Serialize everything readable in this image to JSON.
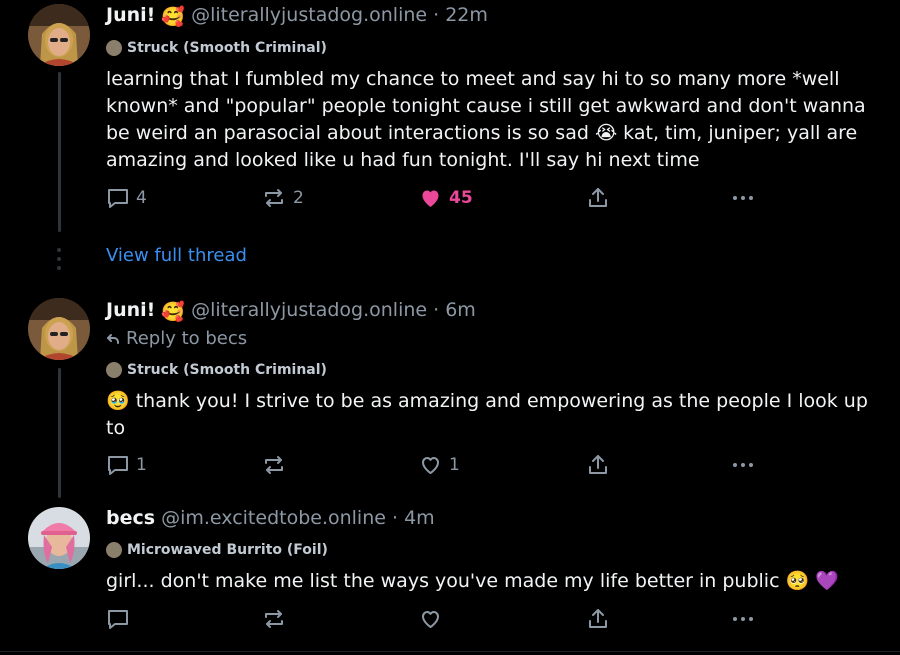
{
  "posts": [
    {
      "display_name": "Juni!",
      "handle": "@literallyjustadog.online",
      "time": "· 22m",
      "label": "Struck (Smooth Criminal)",
      "text": "learning that I fumbled my chance to meet and say hi to so many more *well known* and \"popular\" people tonight cause i still get awkward and don't wanna be weird an parasocial about interactions is so sad 😭 kat, tim, juniper; yall are amazing and looked like u had fun tonight. I'll say hi next time",
      "replies": "4",
      "reposts": "2",
      "likes": "45",
      "liked": true
    },
    {
      "display_name": "Juni!",
      "handle": "@literallyjustadog.online",
      "time": "· 6m",
      "reply_to": "Reply to becs",
      "label": "Struck (Smooth Criminal)",
      "text": "🥹 thank you! I strive to be as amazing and empowering as the people I look up to",
      "replies": "1",
      "reposts": "",
      "likes": "1",
      "liked": false
    },
    {
      "display_name": "becs",
      "handle": "@im.excitedtobe.online",
      "time": "· 4m",
      "label": "Microwaved Burrito (Foil)",
      "text": "girl... don't make me list the ways you've made my life better in public 🥺 💜",
      "replies": "",
      "reposts": "",
      "likes": "",
      "liked": false
    }
  ],
  "view_full_thread": "View full thread",
  "colors": {
    "background": "#000000",
    "link": "#3b8ff0",
    "like_active": "#ec4899",
    "muted": "#8d98a5"
  }
}
